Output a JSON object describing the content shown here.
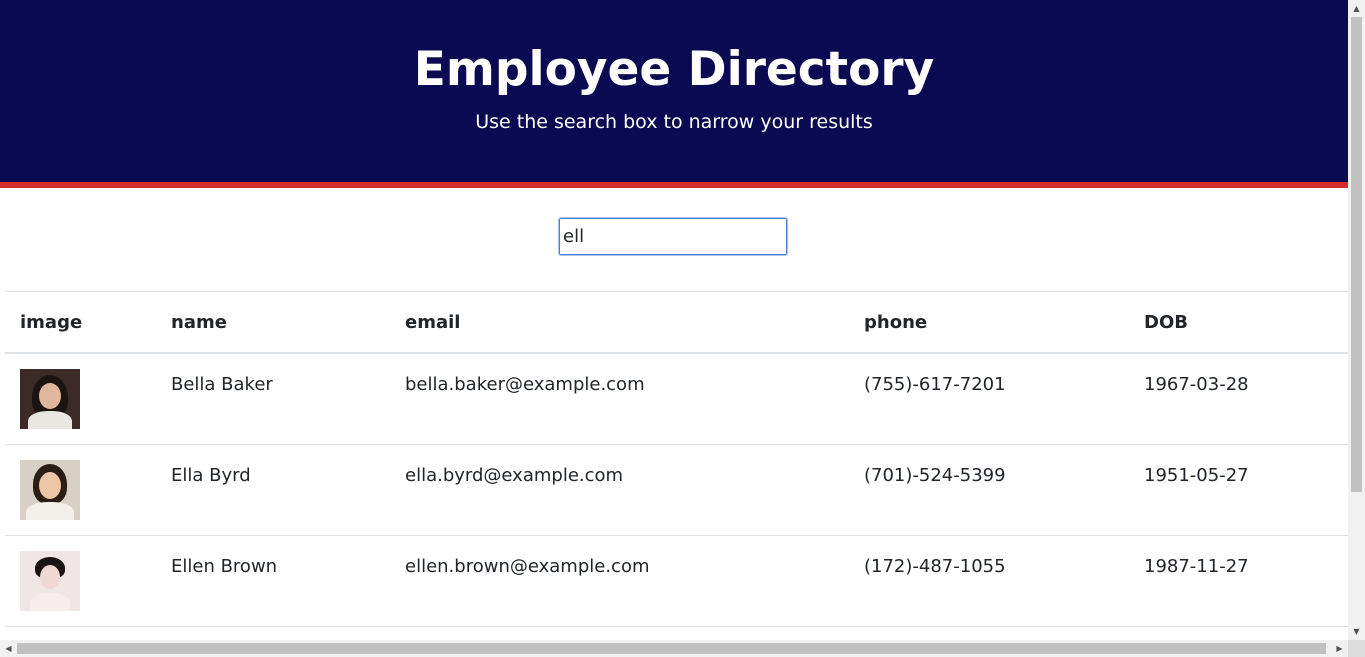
{
  "header": {
    "title": "Employee Directory",
    "subtitle": "Use the search box to narrow your results"
  },
  "search": {
    "value": "ell",
    "placeholder": ""
  },
  "table": {
    "columns": [
      "image",
      "name",
      "email",
      "phone",
      "DOB"
    ],
    "rows": [
      {
        "name": "Bella Baker",
        "email": "bella.baker@example.com",
        "phone": "(755)-617-7201",
        "dob": "1967-03-28",
        "image_icon": "avatar-photo"
      },
      {
        "name": "Ella Byrd",
        "email": "ella.byrd@example.com",
        "phone": "(701)-524-5399",
        "dob": "1951-05-27",
        "image_icon": "avatar-photo"
      },
      {
        "name": "Ellen Brown",
        "email": "ellen.brown@example.com",
        "phone": "(172)-487-1055",
        "dob": "1987-11-27",
        "image_icon": "avatar-photo"
      }
    ]
  },
  "colors": {
    "header_bg": "#0a0a52",
    "header_accent": "#d62f2f",
    "input_focus": "#4a7fd6"
  }
}
